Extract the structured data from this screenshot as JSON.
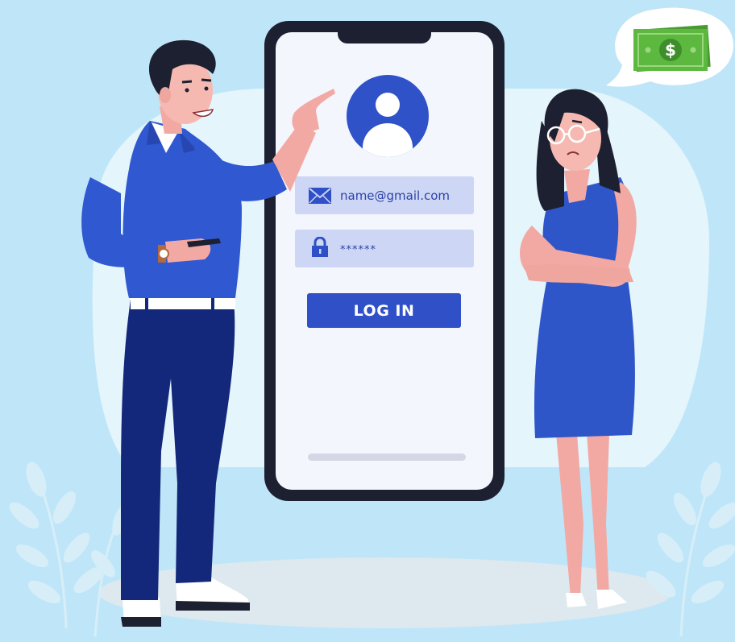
{
  "login_form": {
    "email_value": "name@gmail.com",
    "password_value": "******",
    "login_label": "LOG IN"
  },
  "icons": {
    "email": "envelope-icon",
    "password": "lock-icon",
    "avatar": "user-avatar-icon",
    "money": "banknote-icon"
  },
  "colors": {
    "background": "#bfe6f8",
    "brand_blue": "#2f50c6",
    "field_bg": "#cdd6f5",
    "field_text": "#2d43a6",
    "money_green": "#5cb83e"
  }
}
